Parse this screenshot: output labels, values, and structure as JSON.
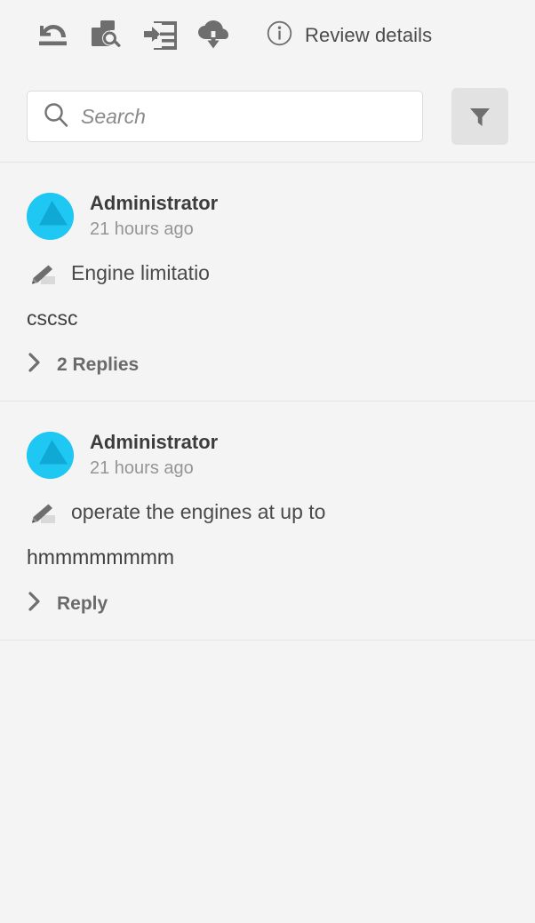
{
  "toolbar": {
    "buttons": [
      {
        "name": "revert-icon",
        "title": "Revert"
      },
      {
        "name": "document-search-icon",
        "title": "Inspect document"
      },
      {
        "name": "import-comments-icon",
        "title": "Import comments"
      },
      {
        "name": "cloud-download-icon",
        "title": "Download"
      }
    ],
    "review_details_label": "Review details",
    "info_icon": "info-circle-icon",
    "icon_color": "#6e6e6e"
  },
  "search": {
    "placeholder": "Search",
    "value": "",
    "icon": "search-icon",
    "filter_icon": "filter-funnel-icon",
    "filter_button_color": "#e2e2e2"
  },
  "comments": [
    {
      "author": "Administrator",
      "time": "21 hours ago",
      "avatar_color": "#1fc8f2",
      "quote_icon": "highlighter-icon",
      "quote": "Engine limitatio",
      "body": "cscsc",
      "replies_label": "2 Replies",
      "chevron_icon": "chevron-right-icon"
    },
    {
      "author": "Administrator",
      "time": "21 hours ago",
      "avatar_color": "#1fc8f2",
      "quote_icon": "highlighter-icon",
      "quote": "operate the engines at up to",
      "body": "hmmmmmmmm",
      "replies_label": "Reply",
      "chevron_icon": "chevron-right-icon"
    }
  ],
  "colors": {
    "background": "#f4f4f4",
    "divider": "#e4e4e4",
    "text_primary": "#3c3c3c",
    "text_secondary": "#959595",
    "accent": "#1fc8f2"
  }
}
